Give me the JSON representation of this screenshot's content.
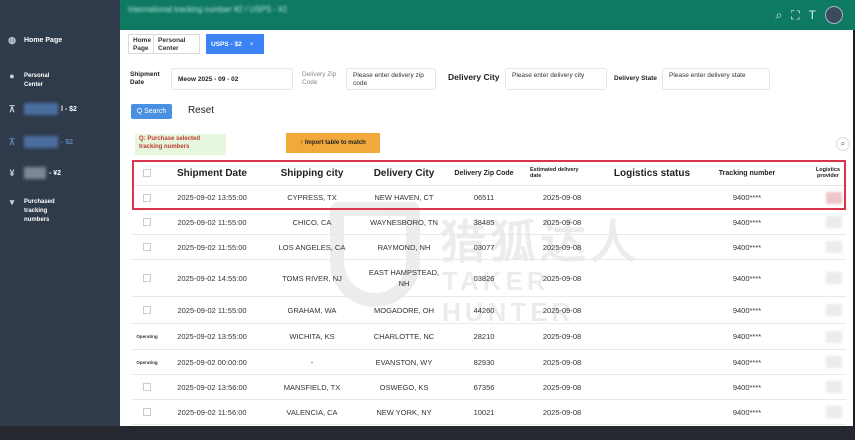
{
  "header": {
    "emojis": [
      "smile-emoji",
      "smile-emoji",
      "smile-emoji"
    ],
    "title": "International tracking number ¥2 / USPS - ¥2",
    "icons": [
      "search-icon",
      "fullscreen-icon",
      "font-size-icon",
      "user-avatar"
    ]
  },
  "sidebar": {
    "items": [
      {
        "label": "Home Page",
        "icon": "globe-icon"
      },
      {
        "label": "Personal Center",
        "icon": "user-icon"
      },
      {
        "label": "l - $2",
        "icon": "chart-icon"
      },
      {
        "label": "- $2",
        "icon": "chart-icon"
      },
      {
        "label": "- ¥2",
        "icon": "dollar-icon"
      },
      {
        "label": "Purchased tracking numbers",
        "icon": "cart-icon"
      }
    ]
  },
  "tabs": [
    {
      "label": "Home Page"
    },
    {
      "label": "Personal Center"
    },
    {
      "label": "USPS - $2",
      "close": "×",
      "active": true
    }
  ],
  "filters": {
    "shipment_date_label": "Shipment Date",
    "shipment_date_value": "Meow 2025 - 09 - 02",
    "delivery_zip_label": "Delivery Zip Code",
    "delivery_zip_placeholder": "Please enter delivery zip code",
    "delivery_city_label": "Delivery City",
    "delivery_city_placeholder": "Please enter delivery city",
    "delivery_state_label": "Delivery State",
    "delivery_state_placeholder": "Please enter delivery state"
  },
  "actions": {
    "search_label": "Q Search",
    "reset_label": "Reset",
    "purchase_selected_label": "Q: Purchase selected tracking numbers",
    "import_label": "↑ Import table to match",
    "search_icon": "search-icon"
  },
  "watermark": {
    "cn": "猎狐达人",
    "en": "TAKER HUNTER"
  },
  "table": {
    "columns": [
      "Shipment Date",
      "Shipping city",
      "Delivery City",
      "Delivery Zip Code",
      "Estimated delivery date",
      "Logistics status",
      "Tracking number",
      "Logistics provider"
    ],
    "rows": [
      {
        "tag": "",
        "shipment_date": "2025-09-02 13:55:00",
        "shipping_city": "CYPRESS, TX",
        "delivery_city": "NEW HAVEN, CT",
        "zip": "06511",
        "est_date": "2025-09-08",
        "status": "",
        "tracking": "9400****",
        "highlighted": true
      },
      {
        "tag": "",
        "shipment_date": "2025-09-02 11:55:00",
        "shipping_city": "CHICO, CA",
        "delivery_city": "WAYNESBORO, TN",
        "zip": "38485",
        "est_date": "2025-09-08",
        "status": "",
        "tracking": "9400****"
      },
      {
        "tag": "",
        "shipment_date": "2025-09-02 11:55:00",
        "shipping_city": "LOS ANGELES, CA",
        "delivery_city": "RAYMOND, NH",
        "zip": "03077",
        "est_date": "2025-09-08",
        "status": "",
        "tracking": "9400****"
      },
      {
        "tag": "",
        "shipment_date": "2025-09-02 14:55:00",
        "shipping_city": "TOMS RIVER, NJ",
        "delivery_city": "EAST HAMPSTEAD, NH",
        "zip": "03826",
        "est_date": "2025-09-08",
        "status": "",
        "tracking": "9400****"
      },
      {
        "tag": "",
        "shipment_date": "2025-09-02 11:55:00",
        "shipping_city": "GRAHAM, WA",
        "delivery_city": "MOGADORE, OH",
        "zip": "44260",
        "est_date": "2025-09-08",
        "status": "",
        "tracking": "9400****"
      },
      {
        "tag": "Operating",
        "shipment_date": "2025-09-02 13:55:00",
        "shipping_city": "WICHITA, KS",
        "delivery_city": "CHARLOTTE, NC",
        "zip": "28210",
        "est_date": "2025-09-08",
        "status": "",
        "tracking": "9400****"
      },
      {
        "tag": "Operating",
        "shipment_date": "2025-09-02 00:00:00",
        "shipping_city": "-",
        "delivery_city": "EVANSTON, WY",
        "zip": "82930",
        "est_date": "2025-09-08",
        "status": "",
        "tracking": "9400****"
      },
      {
        "tag": "",
        "shipment_date": "2025-09-02 13:56:00",
        "shipping_city": "MANSFIELD, TX",
        "delivery_city": "OSWEGO, KS",
        "zip": "67356",
        "est_date": "2025-09-08",
        "status": "",
        "tracking": "9400****"
      },
      {
        "tag": "",
        "shipment_date": "2025-09-02 11:56:00",
        "shipping_city": "VALENCIA, CA",
        "delivery_city": "NEW YORK, NY",
        "zip": "10021",
        "est_date": "2025-09-08",
        "status": "",
        "tracking": "9400****"
      }
    ]
  }
}
